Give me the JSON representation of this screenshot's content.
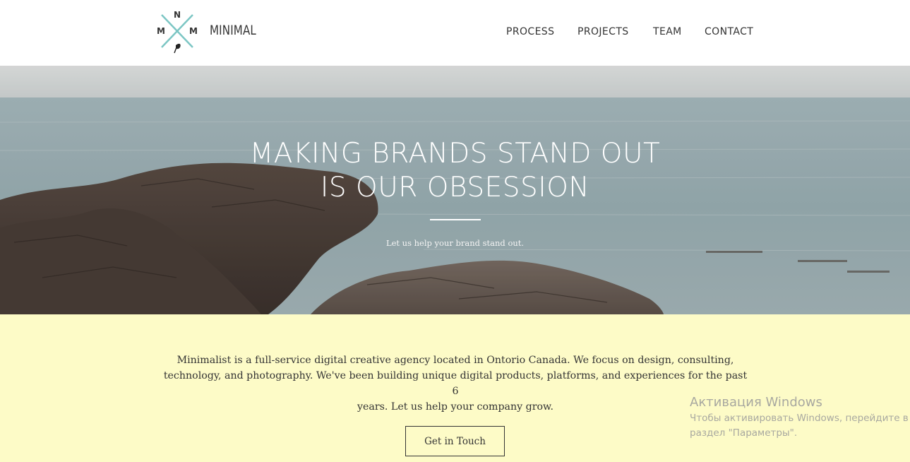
{
  "header": {
    "logo_letters": {
      "top": "N",
      "left": "M",
      "right": "M"
    },
    "brand": "MINIMAL",
    "nav": [
      "PROCESS",
      "PROJECTS",
      "TEAM",
      "CONTACT"
    ]
  },
  "hero": {
    "title_line1": "MAKING BRANDS STAND OUT",
    "title_line2": "IS OUR OBSESSION",
    "subtitle": "Let us help your brand stand out."
  },
  "about": {
    "line1": "Minimalist is a full-service digital creative agency located in Ontorio Canada. We focus on design, consulting,",
    "line2": "technology, and photography. We've been building unique digital products, platforms, and experiences for the past 6",
    "line3": "years. Let us help your company grow.",
    "cta": "Get in Touch"
  },
  "windows_watermark": {
    "title": "Активация Windows",
    "line1": "Чтобы активировать Windows, перейдите в",
    "line2": "раздел \"Параметры\"."
  },
  "colors": {
    "accent": "#7cc6c4",
    "about_bg": "#fdfbc7",
    "text": "#333333"
  }
}
